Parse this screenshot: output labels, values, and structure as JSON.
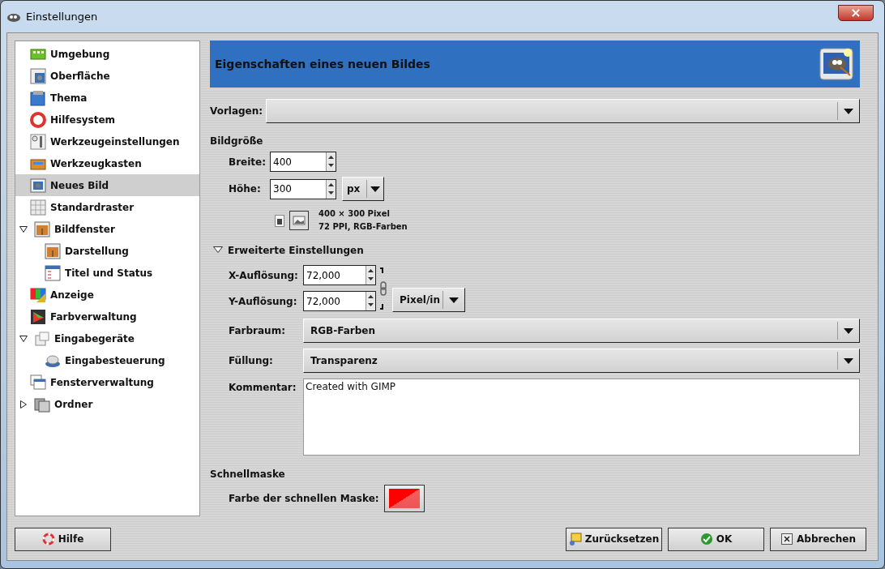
{
  "window": {
    "title": "Einstellungen",
    "close_symbol": "×"
  },
  "sidebar": {
    "items": [
      {
        "label": "Umgebung",
        "selected": false
      },
      {
        "label": "Oberfläche",
        "selected": false
      },
      {
        "label": "Thema",
        "selected": false
      },
      {
        "label": "Hilfesystem",
        "selected": false
      },
      {
        "label": "Werkzeugeinstellungen",
        "selected": false
      },
      {
        "label": "Werkzeugkasten",
        "selected": false
      },
      {
        "label": "Neues Bild",
        "selected": true
      },
      {
        "label": "Standardraster",
        "selected": false
      },
      {
        "label": "Bildfenster",
        "selected": false,
        "expanded": true,
        "children": [
          {
            "label": "Darstellung",
            "selected": false
          },
          {
            "label": "Titel und Status",
            "selected": false
          }
        ]
      },
      {
        "label": "Anzeige",
        "selected": false
      },
      {
        "label": "Farbverwaltung",
        "selected": false
      },
      {
        "label": "Eingabegeräte",
        "selected": false,
        "expanded": true,
        "children": [
          {
            "label": "Eingabesteuerung",
            "selected": false
          }
        ]
      },
      {
        "label": "Fensterverwaltung",
        "selected": false
      },
      {
        "label": "Ordner",
        "selected": false,
        "expanded": false
      }
    ]
  },
  "page": {
    "title": "Eigenschaften eines neuen Bildes",
    "templates": {
      "label": "Vorlagen:"
    },
    "image_size": {
      "heading": "Bildgröße",
      "width": {
        "label": "Breite:",
        "value": "400"
      },
      "height": {
        "label": "Höhe:",
        "value": "300"
      },
      "unit": "px",
      "info_lines": [
        "400 × 300 Pixel",
        "72 PPI, RGB-Farben"
      ]
    },
    "advanced": {
      "label": "Erweiterte Einstellungen",
      "expanded": true,
      "x_resolution": {
        "label": "X-Auflösung:",
        "value": "72,000"
      },
      "y_resolution": {
        "label": "Y-Auflösung:",
        "value": "72,000"
      },
      "resolution_unit": "Pixel/in",
      "color_space": {
        "label": "Farbraum:",
        "value": "RGB-Farben"
      },
      "fill": {
        "label": "Füllung:",
        "value": "Transparenz"
      },
      "comment": {
        "label": "Kommentar:",
        "value": "Created with GIMP"
      }
    },
    "quick_mask": {
      "heading": "Schnellmaske",
      "label": "Farbe der schnellen Maske:",
      "color": "#ff0000"
    }
  },
  "buttons": [
    {
      "kind": "help",
      "label": "Hilfe"
    },
    {
      "kind": "reset",
      "label": "Zurücksetzen"
    },
    {
      "kind": "ok",
      "label": "OK"
    },
    {
      "kind": "cancel",
      "label": "Abbrechen"
    }
  ]
}
